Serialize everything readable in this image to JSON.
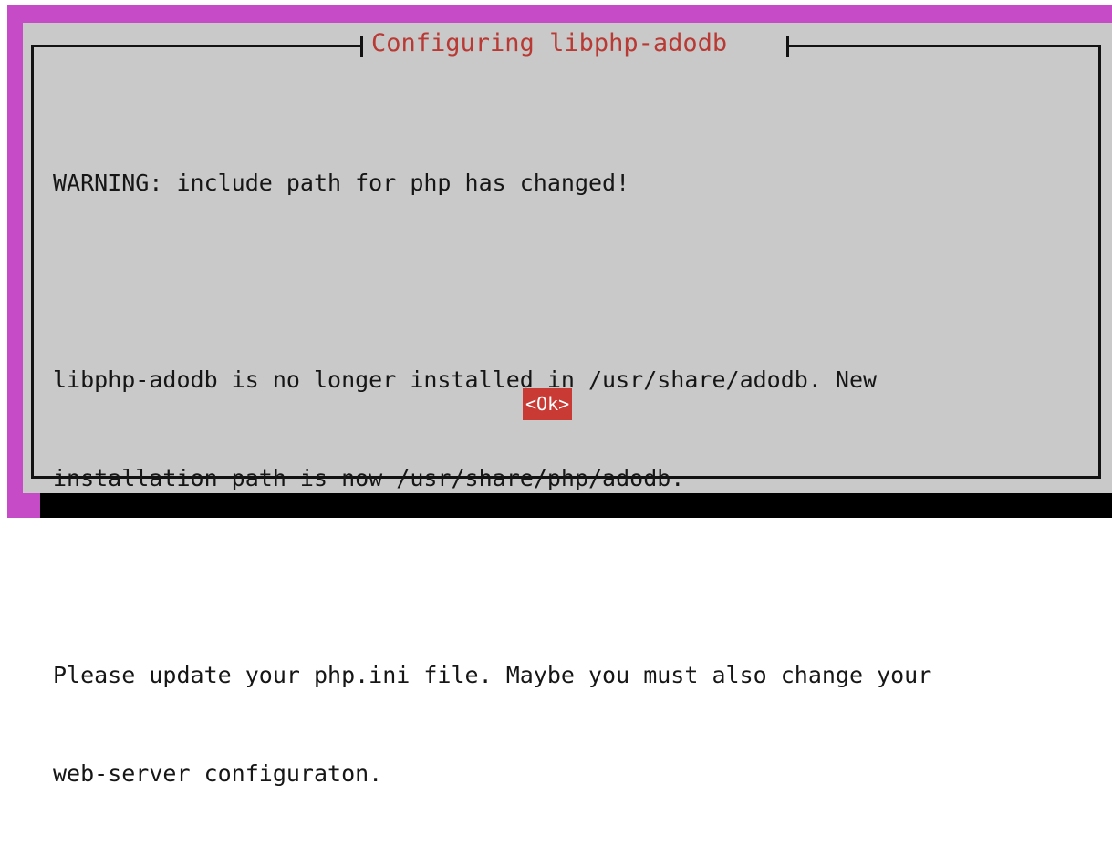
{
  "dialog": {
    "title": "Configuring libphp-adodb",
    "lines": [
      "WARNING: include path for php has changed!",
      "",
      "libphp-adodb is no longer installed in /usr/share/adodb. New",
      "installation path is now /usr/share/php/adodb.",
      "",
      "Please update your php.ini file. Maybe you must also change your",
      "web-server configuraton."
    ],
    "ok_label": "<Ok>"
  },
  "colors": {
    "terminal_background": "#c64bc6",
    "dialog_background": "#c9c9c9",
    "title_text": "#b93a34",
    "button_background": "#c83a33",
    "button_text": "#ffffff"
  }
}
